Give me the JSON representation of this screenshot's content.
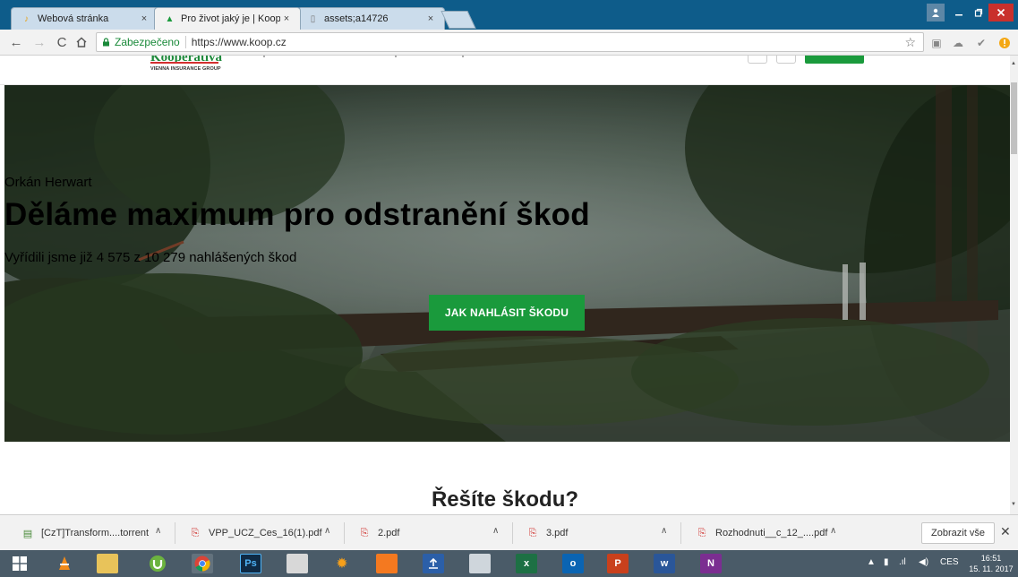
{
  "browser": {
    "tabs": [
      {
        "title": "Webová stránka",
        "icon": "lightbulb-icon"
      },
      {
        "title": "Pro život jaký je | Kooper",
        "icon": "kooperativa-favicon"
      },
      {
        "title": "assets;a14726",
        "icon": "page-icon"
      }
    ],
    "close_glyph": "×",
    "address": {
      "secure_label": "Zabezpečeno",
      "url": "https://www.koop.cz"
    }
  },
  "site": {
    "logo_name": "Kooperativa",
    "logo_sub": "VIENNA INSURANCE GROUP",
    "hero": {
      "kicker": "Orkán Herwart",
      "title": "Děláme maximum pro odstranění škod",
      "subtitle": "Vyřídili jsme již 4 575 z 10 279 nahlášených škod",
      "cta": "JAK NAHLÁSIT ŠKODU"
    },
    "section_title": "Řešíte škodu?"
  },
  "downloads": {
    "items": [
      {
        "name": "[CzT]Transform....torrent",
        "icon": "torrent-file-icon"
      },
      {
        "name": "VPP_UCZ_Ces_16(1).pdf",
        "icon": "pdf-file-icon"
      },
      {
        "name": "2.pdf",
        "icon": "pdf-file-icon"
      },
      {
        "name": "3.pdf",
        "icon": "pdf-file-icon"
      },
      {
        "name": "Rozhodnuti__c_12_....pdf",
        "icon": "pdf-file-icon"
      }
    ],
    "show_all": "Zobrazit vše"
  },
  "taskbar": {
    "apps": [
      "windows-start-icon",
      "vlc-icon",
      "file-explorer-icon",
      "utorrent-icon",
      "chrome-icon",
      "photoshop-icon",
      "app-icon",
      "avast-icon",
      "avast-cleanup-icon",
      "upload-icon",
      "calculator-icon",
      "excel-icon",
      "outlook-icon",
      "powerpoint-icon",
      "word-icon",
      "onenote-icon"
    ],
    "labels": {
      "photoshop": "Ps",
      "excel": "x",
      "outlook": "o",
      "powerpoint": "P",
      "word": "w",
      "onenote": "N"
    },
    "language": "CES",
    "time": "16:51",
    "date": "15. 11. 2017"
  },
  "colors": {
    "brand_green": "#1a9a3c",
    "titlebar_blue": "#0e5c8a",
    "close_red": "#c9302c"
  }
}
